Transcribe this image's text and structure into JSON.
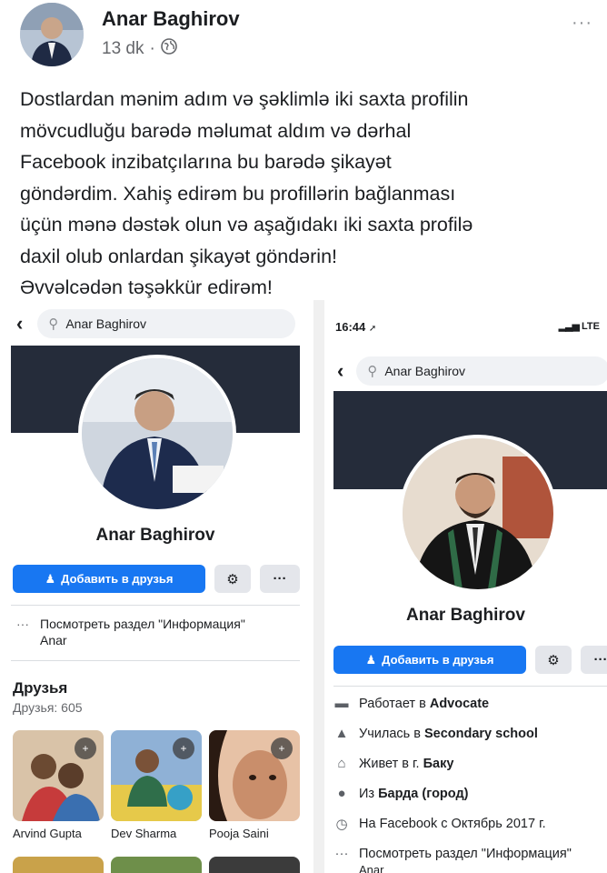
{
  "post": {
    "author": "Anar Baghirov",
    "time": "13 dk",
    "separator": "·",
    "privacy_icon": "globe-icon",
    "more_icon": "more-dots-icon",
    "more_glyph": "···",
    "text": [
      "Dostlardan mənim adım və şəklimlə iki saxta profilin",
      "mövcudluğu barədə məlumat aldım və dərhal",
      "Facebook inzibatçılarına bu barədə şikayət",
      "göndərdim. Xahiş edirəm bu profillərin bağlanması",
      "üçün mənə dəstək olun və aşağıdakı iki saxta profilə",
      "daxil olub onlardan şikayət göndərin!",
      "Əvvəlcədən təşəkkür edirəm!"
    ]
  },
  "left_profile": {
    "back_glyph": "‹",
    "search_text": "Anar Baghirov",
    "name": "Anar Baghirov",
    "add_friend_label": "Добавить в друзья",
    "gear_glyph": "⚙",
    "more_glyph": "···",
    "info_link": "Посмотреть раздел \"Информация\"",
    "info_sub": "Anar",
    "info_dots": "···",
    "friends_title": "Друзья",
    "friends_count": "Друзья: 605",
    "friends": [
      {
        "name": "Arvind Gupta"
      },
      {
        "name": "Dev Sharma"
      },
      {
        "name": "Pooja Saini"
      }
    ],
    "add_badge_glyph": "+"
  },
  "right_profile": {
    "status_time": "16:44",
    "status_arrow": "➚",
    "status_network": "LTE",
    "back_glyph": "‹",
    "search_text": "Anar Baghirov",
    "name": "Anar Baghirov",
    "add_friend_label": "Добавить в друзья",
    "gear_glyph": "⚙",
    "more_glyph": "···",
    "details": [
      {
        "icon": "briefcase-icon",
        "glyph": "▬",
        "prefix": "Работает в ",
        "value": "Advocate"
      },
      {
        "icon": "graduation-cap-icon",
        "glyph": "▲",
        "prefix": "Училась в ",
        "value": "Secondary school"
      },
      {
        "icon": "home-icon",
        "glyph": "⌂",
        "prefix": "Живет в г. ",
        "value": "Баку"
      },
      {
        "icon": "location-pin-icon",
        "glyph": "●",
        "prefix": "Из ",
        "value": "Барда (город)"
      },
      {
        "icon": "clock-icon",
        "glyph": "◷",
        "prefix": "На Facebook с Октябрь 2017 г.",
        "value": ""
      },
      {
        "icon": "more-dots-icon",
        "glyph": "···",
        "prefix": "Посмотреть раздел \"Информация\"",
        "value": ""
      }
    ],
    "details_trailing": "Anar"
  },
  "colors": {
    "facebook_blue": "#1877f2",
    "cover_dark": "#252c3a",
    "grey_button": "#e4e6eb",
    "secondary_text": "#65676b"
  }
}
